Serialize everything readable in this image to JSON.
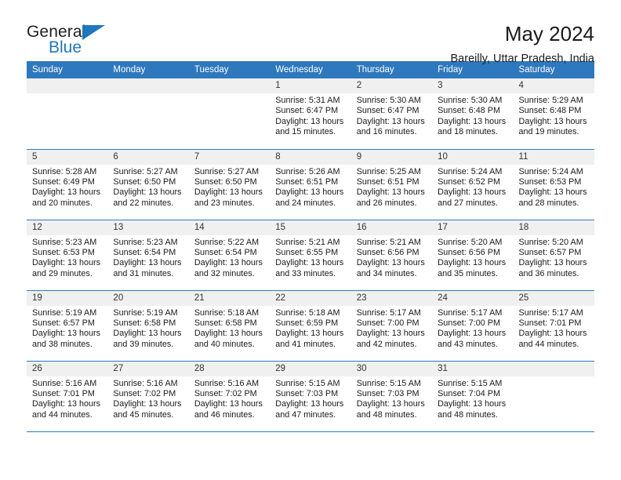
{
  "brand": {
    "name_top": "General",
    "name_bottom": "Blue",
    "triangle_color": "#1f77bd",
    "text_color": "#231f20"
  },
  "header": {
    "title": "May 2024",
    "subtitle": "Bareilly, Uttar Pradesh, India"
  },
  "theme": {
    "header_blue": "#2e78bd",
    "daynum_band": "#f0f0f0",
    "text": "#1a1a1a"
  },
  "calendar": {
    "weekday_headers": [
      "Sunday",
      "Monday",
      "Tuesday",
      "Wednesday",
      "Thursday",
      "Friday",
      "Saturday"
    ],
    "labels": {
      "sunrise": "Sunrise:",
      "sunset": "Sunset:",
      "daylight": "Daylight:"
    },
    "weeks": [
      [
        {
          "day": "",
          "empty": true
        },
        {
          "day": "",
          "empty": true
        },
        {
          "day": "",
          "empty": true
        },
        {
          "day": "1",
          "sunrise": "Sunrise: 5:31 AM",
          "sunset": "Sunset: 6:47 PM",
          "daylight_1": "Daylight: 13 hours",
          "daylight_2": "and 15 minutes."
        },
        {
          "day": "2",
          "sunrise": "Sunrise: 5:30 AM",
          "sunset": "Sunset: 6:47 PM",
          "daylight_1": "Daylight: 13 hours",
          "daylight_2": "and 16 minutes."
        },
        {
          "day": "3",
          "sunrise": "Sunrise: 5:30 AM",
          "sunset": "Sunset: 6:48 PM",
          "daylight_1": "Daylight: 13 hours",
          "daylight_2": "and 18 minutes."
        },
        {
          "day": "4",
          "sunrise": "Sunrise: 5:29 AM",
          "sunset": "Sunset: 6:48 PM",
          "daylight_1": "Daylight: 13 hours",
          "daylight_2": "and 19 minutes."
        }
      ],
      [
        {
          "day": "5",
          "sunrise": "Sunrise: 5:28 AM",
          "sunset": "Sunset: 6:49 PM",
          "daylight_1": "Daylight: 13 hours",
          "daylight_2": "and 20 minutes."
        },
        {
          "day": "6",
          "sunrise": "Sunrise: 5:27 AM",
          "sunset": "Sunset: 6:50 PM",
          "daylight_1": "Daylight: 13 hours",
          "daylight_2": "and 22 minutes."
        },
        {
          "day": "7",
          "sunrise": "Sunrise: 5:27 AM",
          "sunset": "Sunset: 6:50 PM",
          "daylight_1": "Daylight: 13 hours",
          "daylight_2": "and 23 minutes."
        },
        {
          "day": "8",
          "sunrise": "Sunrise: 5:26 AM",
          "sunset": "Sunset: 6:51 PM",
          "daylight_1": "Daylight: 13 hours",
          "daylight_2": "and 24 minutes."
        },
        {
          "day": "9",
          "sunrise": "Sunrise: 5:25 AM",
          "sunset": "Sunset: 6:51 PM",
          "daylight_1": "Daylight: 13 hours",
          "daylight_2": "and 26 minutes."
        },
        {
          "day": "10",
          "sunrise": "Sunrise: 5:24 AM",
          "sunset": "Sunset: 6:52 PM",
          "daylight_1": "Daylight: 13 hours",
          "daylight_2": "and 27 minutes."
        },
        {
          "day": "11",
          "sunrise": "Sunrise: 5:24 AM",
          "sunset": "Sunset: 6:53 PM",
          "daylight_1": "Daylight: 13 hours",
          "daylight_2": "and 28 minutes."
        }
      ],
      [
        {
          "day": "12",
          "sunrise": "Sunrise: 5:23 AM",
          "sunset": "Sunset: 6:53 PM",
          "daylight_1": "Daylight: 13 hours",
          "daylight_2": "and 29 minutes."
        },
        {
          "day": "13",
          "sunrise": "Sunrise: 5:23 AM",
          "sunset": "Sunset: 6:54 PM",
          "daylight_1": "Daylight: 13 hours",
          "daylight_2": "and 31 minutes."
        },
        {
          "day": "14",
          "sunrise": "Sunrise: 5:22 AM",
          "sunset": "Sunset: 6:54 PM",
          "daylight_1": "Daylight: 13 hours",
          "daylight_2": "and 32 minutes."
        },
        {
          "day": "15",
          "sunrise": "Sunrise: 5:21 AM",
          "sunset": "Sunset: 6:55 PM",
          "daylight_1": "Daylight: 13 hours",
          "daylight_2": "and 33 minutes."
        },
        {
          "day": "16",
          "sunrise": "Sunrise: 5:21 AM",
          "sunset": "Sunset: 6:56 PM",
          "daylight_1": "Daylight: 13 hours",
          "daylight_2": "and 34 minutes."
        },
        {
          "day": "17",
          "sunrise": "Sunrise: 5:20 AM",
          "sunset": "Sunset: 6:56 PM",
          "daylight_1": "Daylight: 13 hours",
          "daylight_2": "and 35 minutes."
        },
        {
          "day": "18",
          "sunrise": "Sunrise: 5:20 AM",
          "sunset": "Sunset: 6:57 PM",
          "daylight_1": "Daylight: 13 hours",
          "daylight_2": "and 36 minutes."
        }
      ],
      [
        {
          "day": "19",
          "sunrise": "Sunrise: 5:19 AM",
          "sunset": "Sunset: 6:57 PM",
          "daylight_1": "Daylight: 13 hours",
          "daylight_2": "and 38 minutes."
        },
        {
          "day": "20",
          "sunrise": "Sunrise: 5:19 AM",
          "sunset": "Sunset: 6:58 PM",
          "daylight_1": "Daylight: 13 hours",
          "daylight_2": "and 39 minutes."
        },
        {
          "day": "21",
          "sunrise": "Sunrise: 5:18 AM",
          "sunset": "Sunset: 6:58 PM",
          "daylight_1": "Daylight: 13 hours",
          "daylight_2": "and 40 minutes."
        },
        {
          "day": "22",
          "sunrise": "Sunrise: 5:18 AM",
          "sunset": "Sunset: 6:59 PM",
          "daylight_1": "Daylight: 13 hours",
          "daylight_2": "and 41 minutes."
        },
        {
          "day": "23",
          "sunrise": "Sunrise: 5:17 AM",
          "sunset": "Sunset: 7:00 PM",
          "daylight_1": "Daylight: 13 hours",
          "daylight_2": "and 42 minutes."
        },
        {
          "day": "24",
          "sunrise": "Sunrise: 5:17 AM",
          "sunset": "Sunset: 7:00 PM",
          "daylight_1": "Daylight: 13 hours",
          "daylight_2": "and 43 minutes."
        },
        {
          "day": "25",
          "sunrise": "Sunrise: 5:17 AM",
          "sunset": "Sunset: 7:01 PM",
          "daylight_1": "Daylight: 13 hours",
          "daylight_2": "and 44 minutes."
        }
      ],
      [
        {
          "day": "26",
          "sunrise": "Sunrise: 5:16 AM",
          "sunset": "Sunset: 7:01 PM",
          "daylight_1": "Daylight: 13 hours",
          "daylight_2": "and 44 minutes."
        },
        {
          "day": "27",
          "sunrise": "Sunrise: 5:16 AM",
          "sunset": "Sunset: 7:02 PM",
          "daylight_1": "Daylight: 13 hours",
          "daylight_2": "and 45 minutes."
        },
        {
          "day": "28",
          "sunrise": "Sunrise: 5:16 AM",
          "sunset": "Sunset: 7:02 PM",
          "daylight_1": "Daylight: 13 hours",
          "daylight_2": "and 46 minutes."
        },
        {
          "day": "29",
          "sunrise": "Sunrise: 5:15 AM",
          "sunset": "Sunset: 7:03 PM",
          "daylight_1": "Daylight: 13 hours",
          "daylight_2": "and 47 minutes."
        },
        {
          "day": "30",
          "sunrise": "Sunrise: 5:15 AM",
          "sunset": "Sunset: 7:03 PM",
          "daylight_1": "Daylight: 13 hours",
          "daylight_2": "and 48 minutes."
        },
        {
          "day": "31",
          "sunrise": "Sunrise: 5:15 AM",
          "sunset": "Sunset: 7:04 PM",
          "daylight_1": "Daylight: 13 hours",
          "daylight_2": "and 48 minutes."
        },
        {
          "day": "",
          "empty": true
        }
      ]
    ]
  }
}
